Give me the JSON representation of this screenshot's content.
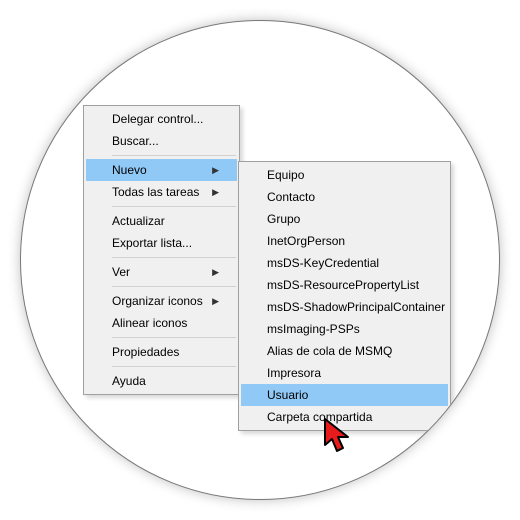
{
  "background": {
    "label": "Grupo"
  },
  "primaryMenu": {
    "items": [
      {
        "label": "Delegar control..."
      },
      {
        "label": "Buscar..."
      },
      {
        "label": "Nuevo",
        "hasSubmenu": true,
        "highlighted": true
      },
      {
        "label": "Todas las tareas",
        "hasSubmenu": true
      },
      {
        "label": "Actualizar"
      },
      {
        "label": "Exportar lista..."
      },
      {
        "label": "Ver",
        "hasSubmenu": true
      },
      {
        "label": "Organizar iconos",
        "hasSubmenu": true
      },
      {
        "label": "Alinear iconos"
      },
      {
        "label": "Propiedades"
      },
      {
        "label": "Ayuda"
      }
    ]
  },
  "subMenu": {
    "items": [
      {
        "label": "Equipo"
      },
      {
        "label": "Contacto"
      },
      {
        "label": "Grupo"
      },
      {
        "label": "InetOrgPerson"
      },
      {
        "label": "msDS-KeyCredential"
      },
      {
        "label": "msDS-ResourcePropertyList"
      },
      {
        "label": "msDS-ShadowPrincipalContainer"
      },
      {
        "label": "msImaging-PSPs"
      },
      {
        "label": "Alias de cola de MSMQ"
      },
      {
        "label": "Impresora"
      },
      {
        "label": "Usuario",
        "highlighted": true
      },
      {
        "label": "Carpeta compartida"
      }
    ]
  }
}
